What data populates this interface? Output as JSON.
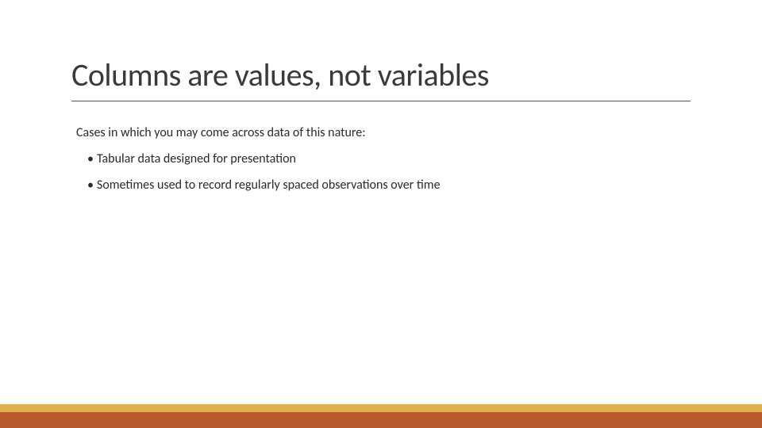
{
  "title": "Columns are values, not variables",
  "subtitle": "Cases in which you may come across data of this nature:",
  "bullets": [
    "Tabular data designed for presentation",
    "Sometimes used to record regularly spaced observations over time"
  ],
  "colors": {
    "footerTop": "#e0b050",
    "footerBottom": "#b75a2e"
  }
}
